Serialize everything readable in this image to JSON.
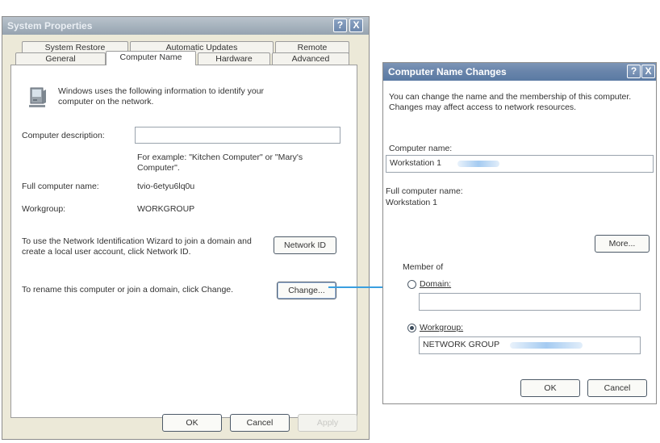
{
  "system_properties": {
    "title": "System Properties",
    "help_btn": "?",
    "close_btn": "X",
    "tabs_row1": [
      "System Restore",
      "Automatic Updates",
      "Remote"
    ],
    "tabs_row2": [
      "General",
      "Computer Name",
      "Hardware",
      "Advanced"
    ],
    "active_tab": "Computer Name",
    "info_text": "Windows uses the following information to identify your computer on the network.",
    "desc_label": "Computer description:",
    "desc_value": "",
    "example_text": "For example: \"Kitchen Computer\" or \"Mary's Computer\".",
    "fullname_label": "Full computer name:",
    "fullname_value": "tvio-6etyu6lq0u",
    "workgroup_label": "Workgroup:",
    "workgroup_value": "WORKGROUP",
    "network_id_text": "To use the Network Identification Wizard to join a domain and create a local user account, click Network ID.",
    "network_id_btn": "Network ID",
    "rename_text": "To rename this computer or join a domain, click Change.",
    "change_btn": "Change...",
    "ok_btn": "OK",
    "cancel_btn": "Cancel",
    "apply_btn": "Apply"
  },
  "name_changes": {
    "title": "Computer Name Changes",
    "help_btn": "?",
    "close_btn": "X",
    "intro_text": "You can change the name and the membership of this computer. Changes may affect access to network resources.",
    "computer_name_label": "Computer name:",
    "computer_name_value": "Workstation 1",
    "full_name_label": "Full computer name:",
    "full_name_value": "Workstation 1",
    "more_btn": "More...",
    "member_of_label": "Member of",
    "domain_label": "Domain:",
    "domain_value": "",
    "workgroup_label": "Workgroup:",
    "workgroup_value": "NETWORK GROUP",
    "selected_membership": "Workgroup",
    "ok_btn": "OK",
    "cancel_btn": "Cancel"
  },
  "colors": {
    "connector": "#3a9fe0",
    "titlebar_blue": "#6a85ab",
    "dialog_bg": "#ece9d8"
  },
  "icons": {
    "computer": "computer-monitor-icon"
  }
}
